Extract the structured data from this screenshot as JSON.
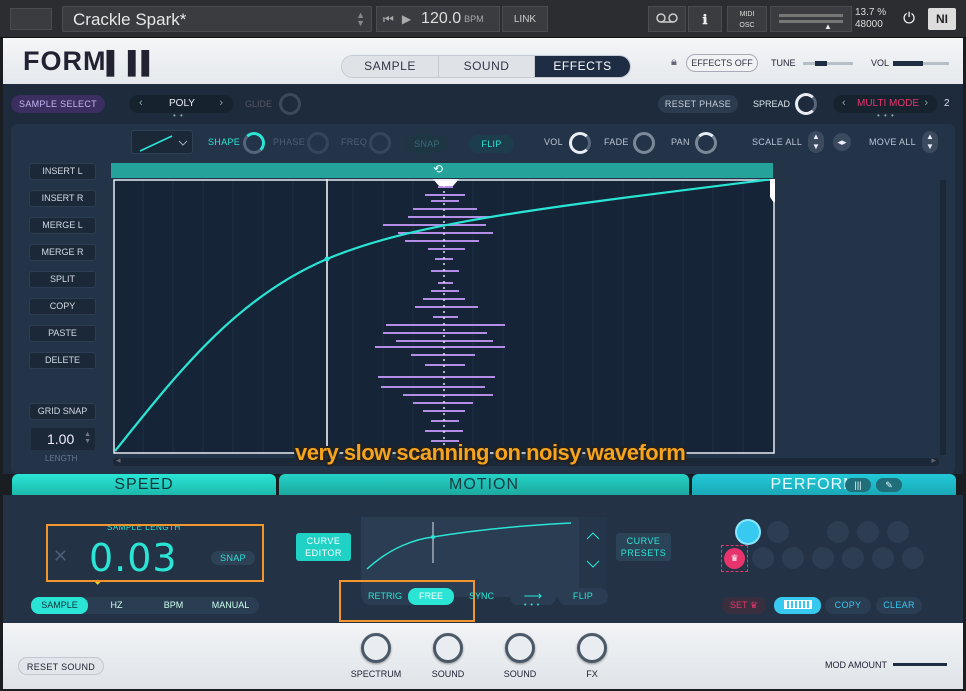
{
  "host": {
    "preset_name": "Crackle Spark*",
    "tempo": "120.0",
    "tempo_unit": "BPM",
    "link_label": "LINK",
    "midi_label_1": "MIDI",
    "midi_label_2": "OSC",
    "cpu": "13.7 %",
    "sample_rate": "48000",
    "ni_logo": "NI"
  },
  "header": {
    "logo": "FORM",
    "tabs": [
      "SAMPLE",
      "SOUND",
      "EFFECTS"
    ],
    "active_tab": "EFFECTS",
    "effects_off": "EFFECTS OFF",
    "tune_label": "TUNE",
    "vol_label": "VOL"
  },
  "toolbar": {
    "sample_select": "SAMPLE SELECT",
    "poly": "POLY",
    "glide": "GLIDE",
    "reset_phase": "RESET PHASE",
    "spread": "SPREAD",
    "multi_mode": "MULTI MODE",
    "multi_count": "2"
  },
  "editor_toolbar": {
    "shape": "SHAPE",
    "phase": "PHASE",
    "freq": "FREQ",
    "snap": "SNAP",
    "flip": "FLIP",
    "vol": "VOL",
    "fade": "FADE",
    "pan": "PAN",
    "scale_all": "SCALE ALL",
    "move_all": "MOVE ALL"
  },
  "side_buttons": [
    "INSERT L",
    "INSERT R",
    "MERGE L",
    "MERGE R",
    "SPLIT",
    "COPY",
    "PASTE",
    "DELETE"
  ],
  "grid_snap": "GRID SNAP",
  "length": {
    "value": "1.00",
    "label": "LENGTH"
  },
  "caption": "very slow scanning on noisy waveform",
  "sections": {
    "speed": "SPEED",
    "motion": "MOTION",
    "perform": "PERFORM"
  },
  "speed": {
    "sample_length_label": "SAMPLE LENGTH",
    "value": "0.03",
    "snap": "SNAP",
    "modes": [
      "SAMPLE",
      "HZ",
      "BPM",
      "MANUAL"
    ],
    "active_mode": "SAMPLE"
  },
  "motion": {
    "curve_editor": "CURVE EDITOR",
    "curve_presets": "CURVE PRESETS",
    "retrig": "RETRIG",
    "free": "FREE",
    "sync": "SYNC",
    "flip": "FLIP"
  },
  "perform": {
    "set": "SET",
    "copy": "COPY",
    "clear": "CLEAR"
  },
  "footer": {
    "reset_sound": "RESET SOUND",
    "knobs": [
      "SPECTRUM",
      "SOUND",
      "SOUND",
      "FX"
    ],
    "mod_amount": "MOD AMOUNT"
  },
  "colors": {
    "accent": "#2ae5d5",
    "pink": "#e8346d",
    "waveform": "#b38de6",
    "highlight": "#f0962c"
  }
}
